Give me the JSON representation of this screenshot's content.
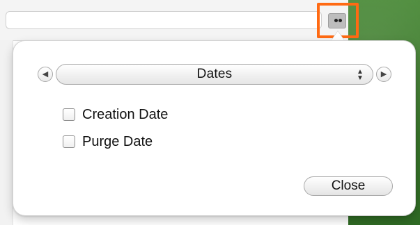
{
  "toolbar": {
    "icon": "view-options-icon"
  },
  "popover": {
    "dates_selector": {
      "value": "Dates"
    },
    "options": [
      {
        "label": "Creation Date",
        "checked": false
      },
      {
        "label": "Purge Date",
        "checked": false
      }
    ],
    "close_label": "Close"
  },
  "colors": {
    "highlight": "#ff6a13",
    "background_green": "#3e7a2e"
  }
}
